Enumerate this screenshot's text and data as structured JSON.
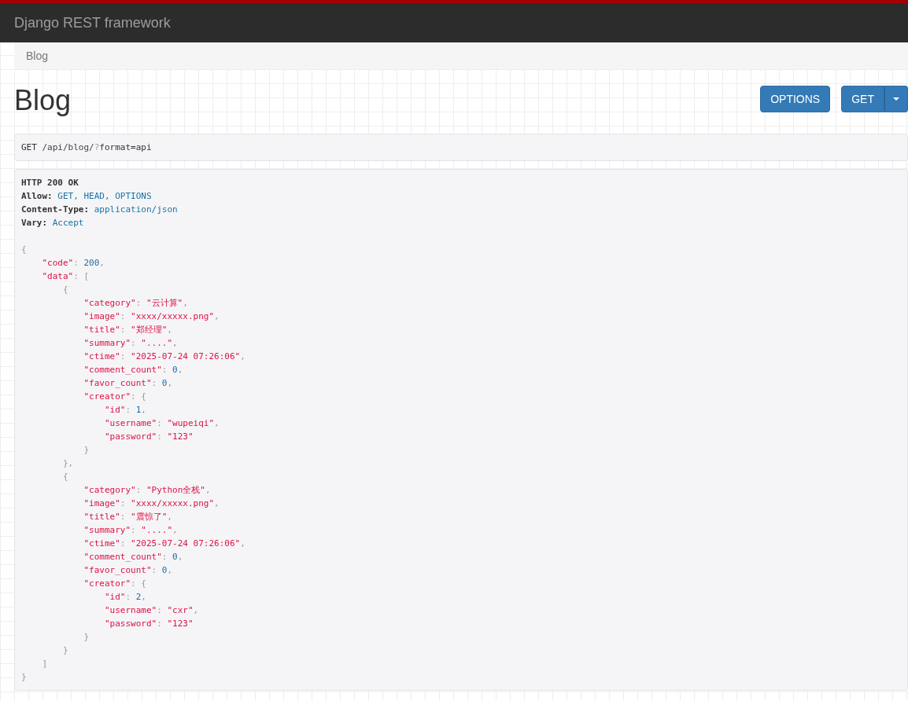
{
  "navbar": {
    "brand": "Django REST framework"
  },
  "breadcrumb": [
    {
      "label": "Blog",
      "active": true
    }
  ],
  "page_title": "Blog",
  "actions": [
    {
      "label": "OPTIONS",
      "kind": "button"
    },
    {
      "label": "GET",
      "kind": "split"
    }
  ],
  "request": {
    "method": "GET",
    "path": "/api/blog/",
    "query_mark": "?",
    "query": "format=api"
  },
  "response": {
    "status": "HTTP 200 OK",
    "headers": [
      {
        "name": "Allow:",
        "value": "GET, HEAD, OPTIONS"
      },
      {
        "name": "Content-Type:",
        "value": "application/json"
      },
      {
        "name": "Vary:",
        "value": "Accept"
      }
    ],
    "body": [
      {
        "tokens": [
          {
            "kind": "punct",
            "text": "{"
          }
        ],
        "children": [
          {
            "tokens": [
              {
                "kind": "key",
                "text": "\"code\""
              },
              {
                "kind": "punct",
                "text": ": "
              },
              {
                "kind": "number",
                "text": "200"
              },
              {
                "kind": "punct",
                "text": ","
              }
            ]
          },
          {
            "tokens": [
              {
                "kind": "key",
                "text": "\"data\""
              },
              {
                "kind": "punct",
                "text": ": ["
              }
            ],
            "children": [
              {
                "tokens": [
                  {
                    "kind": "punct",
                    "text": "{"
                  }
                ],
                "children": [
                  {
                    "tokens": [
                      {
                        "kind": "key",
                        "text": "\"category\""
                      },
                      {
                        "kind": "punct",
                        "text": ": "
                      },
                      {
                        "kind": "string",
                        "text": "\"云计算\""
                      },
                      {
                        "kind": "punct",
                        "text": ","
                      }
                    ]
                  },
                  {
                    "tokens": [
                      {
                        "kind": "key",
                        "text": "\"image\""
                      },
                      {
                        "kind": "punct",
                        "text": ": "
                      },
                      {
                        "kind": "string",
                        "text": "\"xxxx/xxxxx.png\""
                      },
                      {
                        "kind": "punct",
                        "text": ","
                      }
                    ]
                  },
                  {
                    "tokens": [
                      {
                        "kind": "key",
                        "text": "\"title\""
                      },
                      {
                        "kind": "punct",
                        "text": ": "
                      },
                      {
                        "kind": "string",
                        "text": "\"郑经理\""
                      },
                      {
                        "kind": "punct",
                        "text": ","
                      }
                    ]
                  },
                  {
                    "tokens": [
                      {
                        "kind": "key",
                        "text": "\"summary\""
                      },
                      {
                        "kind": "punct",
                        "text": ": "
                      },
                      {
                        "kind": "string",
                        "text": "\"....\""
                      },
                      {
                        "kind": "punct",
                        "text": ","
                      }
                    ]
                  },
                  {
                    "tokens": [
                      {
                        "kind": "key",
                        "text": "\"ctime\""
                      },
                      {
                        "kind": "punct",
                        "text": ": "
                      },
                      {
                        "kind": "string",
                        "text": "\"2025-07-24 07:26:06\""
                      },
                      {
                        "kind": "punct",
                        "text": ","
                      }
                    ]
                  },
                  {
                    "tokens": [
                      {
                        "kind": "key",
                        "text": "\"comment_count\""
                      },
                      {
                        "kind": "punct",
                        "text": ": "
                      },
                      {
                        "kind": "number",
                        "text": "0"
                      },
                      {
                        "kind": "punct",
                        "text": ","
                      }
                    ]
                  },
                  {
                    "tokens": [
                      {
                        "kind": "key",
                        "text": "\"favor_count\""
                      },
                      {
                        "kind": "punct",
                        "text": ": "
                      },
                      {
                        "kind": "number",
                        "text": "0"
                      },
                      {
                        "kind": "punct",
                        "text": ","
                      }
                    ]
                  },
                  {
                    "tokens": [
                      {
                        "kind": "key",
                        "text": "\"creator\""
                      },
                      {
                        "kind": "punct",
                        "text": ": {"
                      }
                    ],
                    "children": [
                      {
                        "tokens": [
                          {
                            "kind": "key",
                            "text": "\"id\""
                          },
                          {
                            "kind": "punct",
                            "text": ": "
                          },
                          {
                            "kind": "number",
                            "text": "1"
                          },
                          {
                            "kind": "punct",
                            "text": ","
                          }
                        ]
                      },
                      {
                        "tokens": [
                          {
                            "kind": "key",
                            "text": "\"username\""
                          },
                          {
                            "kind": "punct",
                            "text": ": "
                          },
                          {
                            "kind": "string",
                            "text": "\"wupeiqi\""
                          },
                          {
                            "kind": "punct",
                            "text": ","
                          }
                        ]
                      },
                      {
                        "tokens": [
                          {
                            "kind": "key",
                            "text": "\"password\""
                          },
                          {
                            "kind": "punct",
                            "text": ": "
                          },
                          {
                            "kind": "string",
                            "text": "\"123\""
                          }
                        ]
                      }
                    ]
                  },
                  {
                    "tokens": [
                      {
                        "kind": "punct",
                        "text": "}"
                      }
                    ]
                  }
                ]
              },
              {
                "tokens": [
                  {
                    "kind": "punct",
                    "text": "},"
                  }
                ]
              },
              {
                "tokens": [
                  {
                    "kind": "punct",
                    "text": "{"
                  }
                ],
                "children": [
                  {
                    "tokens": [
                      {
                        "kind": "key",
                        "text": "\"category\""
                      },
                      {
                        "kind": "punct",
                        "text": ": "
                      },
                      {
                        "kind": "string",
                        "text": "\"Python全栈\""
                      },
                      {
                        "kind": "punct",
                        "text": ","
                      }
                    ]
                  },
                  {
                    "tokens": [
                      {
                        "kind": "key",
                        "text": "\"image\""
                      },
                      {
                        "kind": "punct",
                        "text": ": "
                      },
                      {
                        "kind": "string",
                        "text": "\"xxxx/xxxxx.png\""
                      },
                      {
                        "kind": "punct",
                        "text": ","
                      }
                    ]
                  },
                  {
                    "tokens": [
                      {
                        "kind": "key",
                        "text": "\"title\""
                      },
                      {
                        "kind": "punct",
                        "text": ": "
                      },
                      {
                        "kind": "string",
                        "text": "\"震惊了\""
                      },
                      {
                        "kind": "punct",
                        "text": ","
                      }
                    ]
                  },
                  {
                    "tokens": [
                      {
                        "kind": "key",
                        "text": "\"summary\""
                      },
                      {
                        "kind": "punct",
                        "text": ": "
                      },
                      {
                        "kind": "string",
                        "text": "\"....\""
                      },
                      {
                        "kind": "punct",
                        "text": ","
                      }
                    ]
                  },
                  {
                    "tokens": [
                      {
                        "kind": "key",
                        "text": "\"ctime\""
                      },
                      {
                        "kind": "punct",
                        "text": ": "
                      },
                      {
                        "kind": "string",
                        "text": "\"2025-07-24 07:26:06\""
                      },
                      {
                        "kind": "punct",
                        "text": ","
                      }
                    ]
                  },
                  {
                    "tokens": [
                      {
                        "kind": "key",
                        "text": "\"comment_count\""
                      },
                      {
                        "kind": "punct",
                        "text": ": "
                      },
                      {
                        "kind": "number",
                        "text": "0"
                      },
                      {
                        "kind": "punct",
                        "text": ","
                      }
                    ]
                  },
                  {
                    "tokens": [
                      {
                        "kind": "key",
                        "text": "\"favor_count\""
                      },
                      {
                        "kind": "punct",
                        "text": ": "
                      },
                      {
                        "kind": "number",
                        "text": "0"
                      },
                      {
                        "kind": "punct",
                        "text": ","
                      }
                    ]
                  },
                  {
                    "tokens": [
                      {
                        "kind": "key",
                        "text": "\"creator\""
                      },
                      {
                        "kind": "punct",
                        "text": ": {"
                      }
                    ],
                    "children": [
                      {
                        "tokens": [
                          {
                            "kind": "key",
                            "text": "\"id\""
                          },
                          {
                            "kind": "punct",
                            "text": ": "
                          },
                          {
                            "kind": "number",
                            "text": "2"
                          },
                          {
                            "kind": "punct",
                            "text": ","
                          }
                        ]
                      },
                      {
                        "tokens": [
                          {
                            "kind": "key",
                            "text": "\"username\""
                          },
                          {
                            "kind": "punct",
                            "text": ": "
                          },
                          {
                            "kind": "string",
                            "text": "\"cxr\""
                          },
                          {
                            "kind": "punct",
                            "text": ","
                          }
                        ]
                      },
                      {
                        "tokens": [
                          {
                            "kind": "key",
                            "text": "\"password\""
                          },
                          {
                            "kind": "punct",
                            "text": ": "
                          },
                          {
                            "kind": "string",
                            "text": "\"123\""
                          }
                        ]
                      }
                    ]
                  },
                  {
                    "tokens": [
                      {
                        "kind": "punct",
                        "text": "}"
                      }
                    ]
                  }
                ]
              },
              {
                "tokens": [
                  {
                    "kind": "punct",
                    "text": "}"
                  }
                ]
              }
            ]
          },
          {
            "tokens": [
              {
                "kind": "punct",
                "text": "]"
              }
            ]
          }
        ]
      },
      {
        "tokens": [
          {
            "kind": "punct",
            "text": "}"
          }
        ]
      }
    ]
  }
}
